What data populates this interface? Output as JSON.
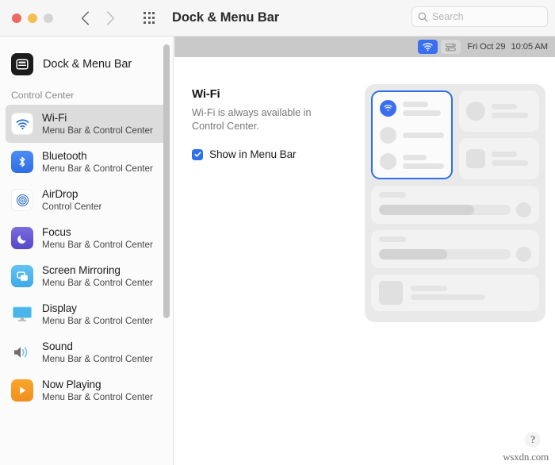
{
  "window": {
    "title": "Dock & Menu Bar",
    "traffic_lights": [
      "close",
      "minimize",
      "zoom"
    ],
    "back_label": "Back",
    "forward_label": "Forward",
    "grid_label": "Show All"
  },
  "search": {
    "placeholder": "Search",
    "value": "",
    "icon": "search-icon"
  },
  "sidebar": {
    "app": {
      "label": "Dock & Menu Bar",
      "icon": "dock-menu-bar-icon"
    },
    "group_title": "Control Center",
    "items": [
      {
        "title": "Wi-Fi",
        "subtitle": "Menu Bar & Control Center",
        "icon": "wifi-icon",
        "selected": true
      },
      {
        "title": "Bluetooth",
        "subtitle": "Menu Bar & Control Center",
        "icon": "bluetooth-icon",
        "selected": false
      },
      {
        "title": "AirDrop",
        "subtitle": "Control Center",
        "icon": "airdrop-icon",
        "selected": false
      },
      {
        "title": "Focus",
        "subtitle": "Menu Bar & Control Center",
        "icon": "focus-moon-icon",
        "selected": false
      },
      {
        "title": "Screen Mirroring",
        "subtitle": "Menu Bar & Control Center",
        "icon": "screen-mirroring-icon",
        "selected": false
      },
      {
        "title": "Display",
        "subtitle": "Menu Bar & Control Center",
        "icon": "display-icon",
        "selected": false
      },
      {
        "title": "Sound",
        "subtitle": "Menu Bar & Control Center",
        "icon": "sound-icon",
        "selected": false
      },
      {
        "title": "Now Playing",
        "subtitle": "Menu Bar & Control Center",
        "icon": "now-playing-icon",
        "selected": false
      }
    ]
  },
  "menubar_preview": {
    "wifi_icon": "wifi-icon",
    "control_center_icon": "control-center-icon",
    "date": "Fri Oct 29",
    "time": "10:05 AM"
  },
  "detail": {
    "heading": "Wi-Fi",
    "description": "Wi-Fi is always available in Control Center.",
    "checkbox": {
      "label": "Show in Menu Bar",
      "checked": true
    }
  },
  "control_center_preview": {
    "highlighted_module": "wifi-module",
    "highlight_color": "#2f6fe8",
    "accent_color": "#3a6ff0"
  },
  "footer": {
    "help_label": "?",
    "watermark": "wsxdn.com"
  }
}
